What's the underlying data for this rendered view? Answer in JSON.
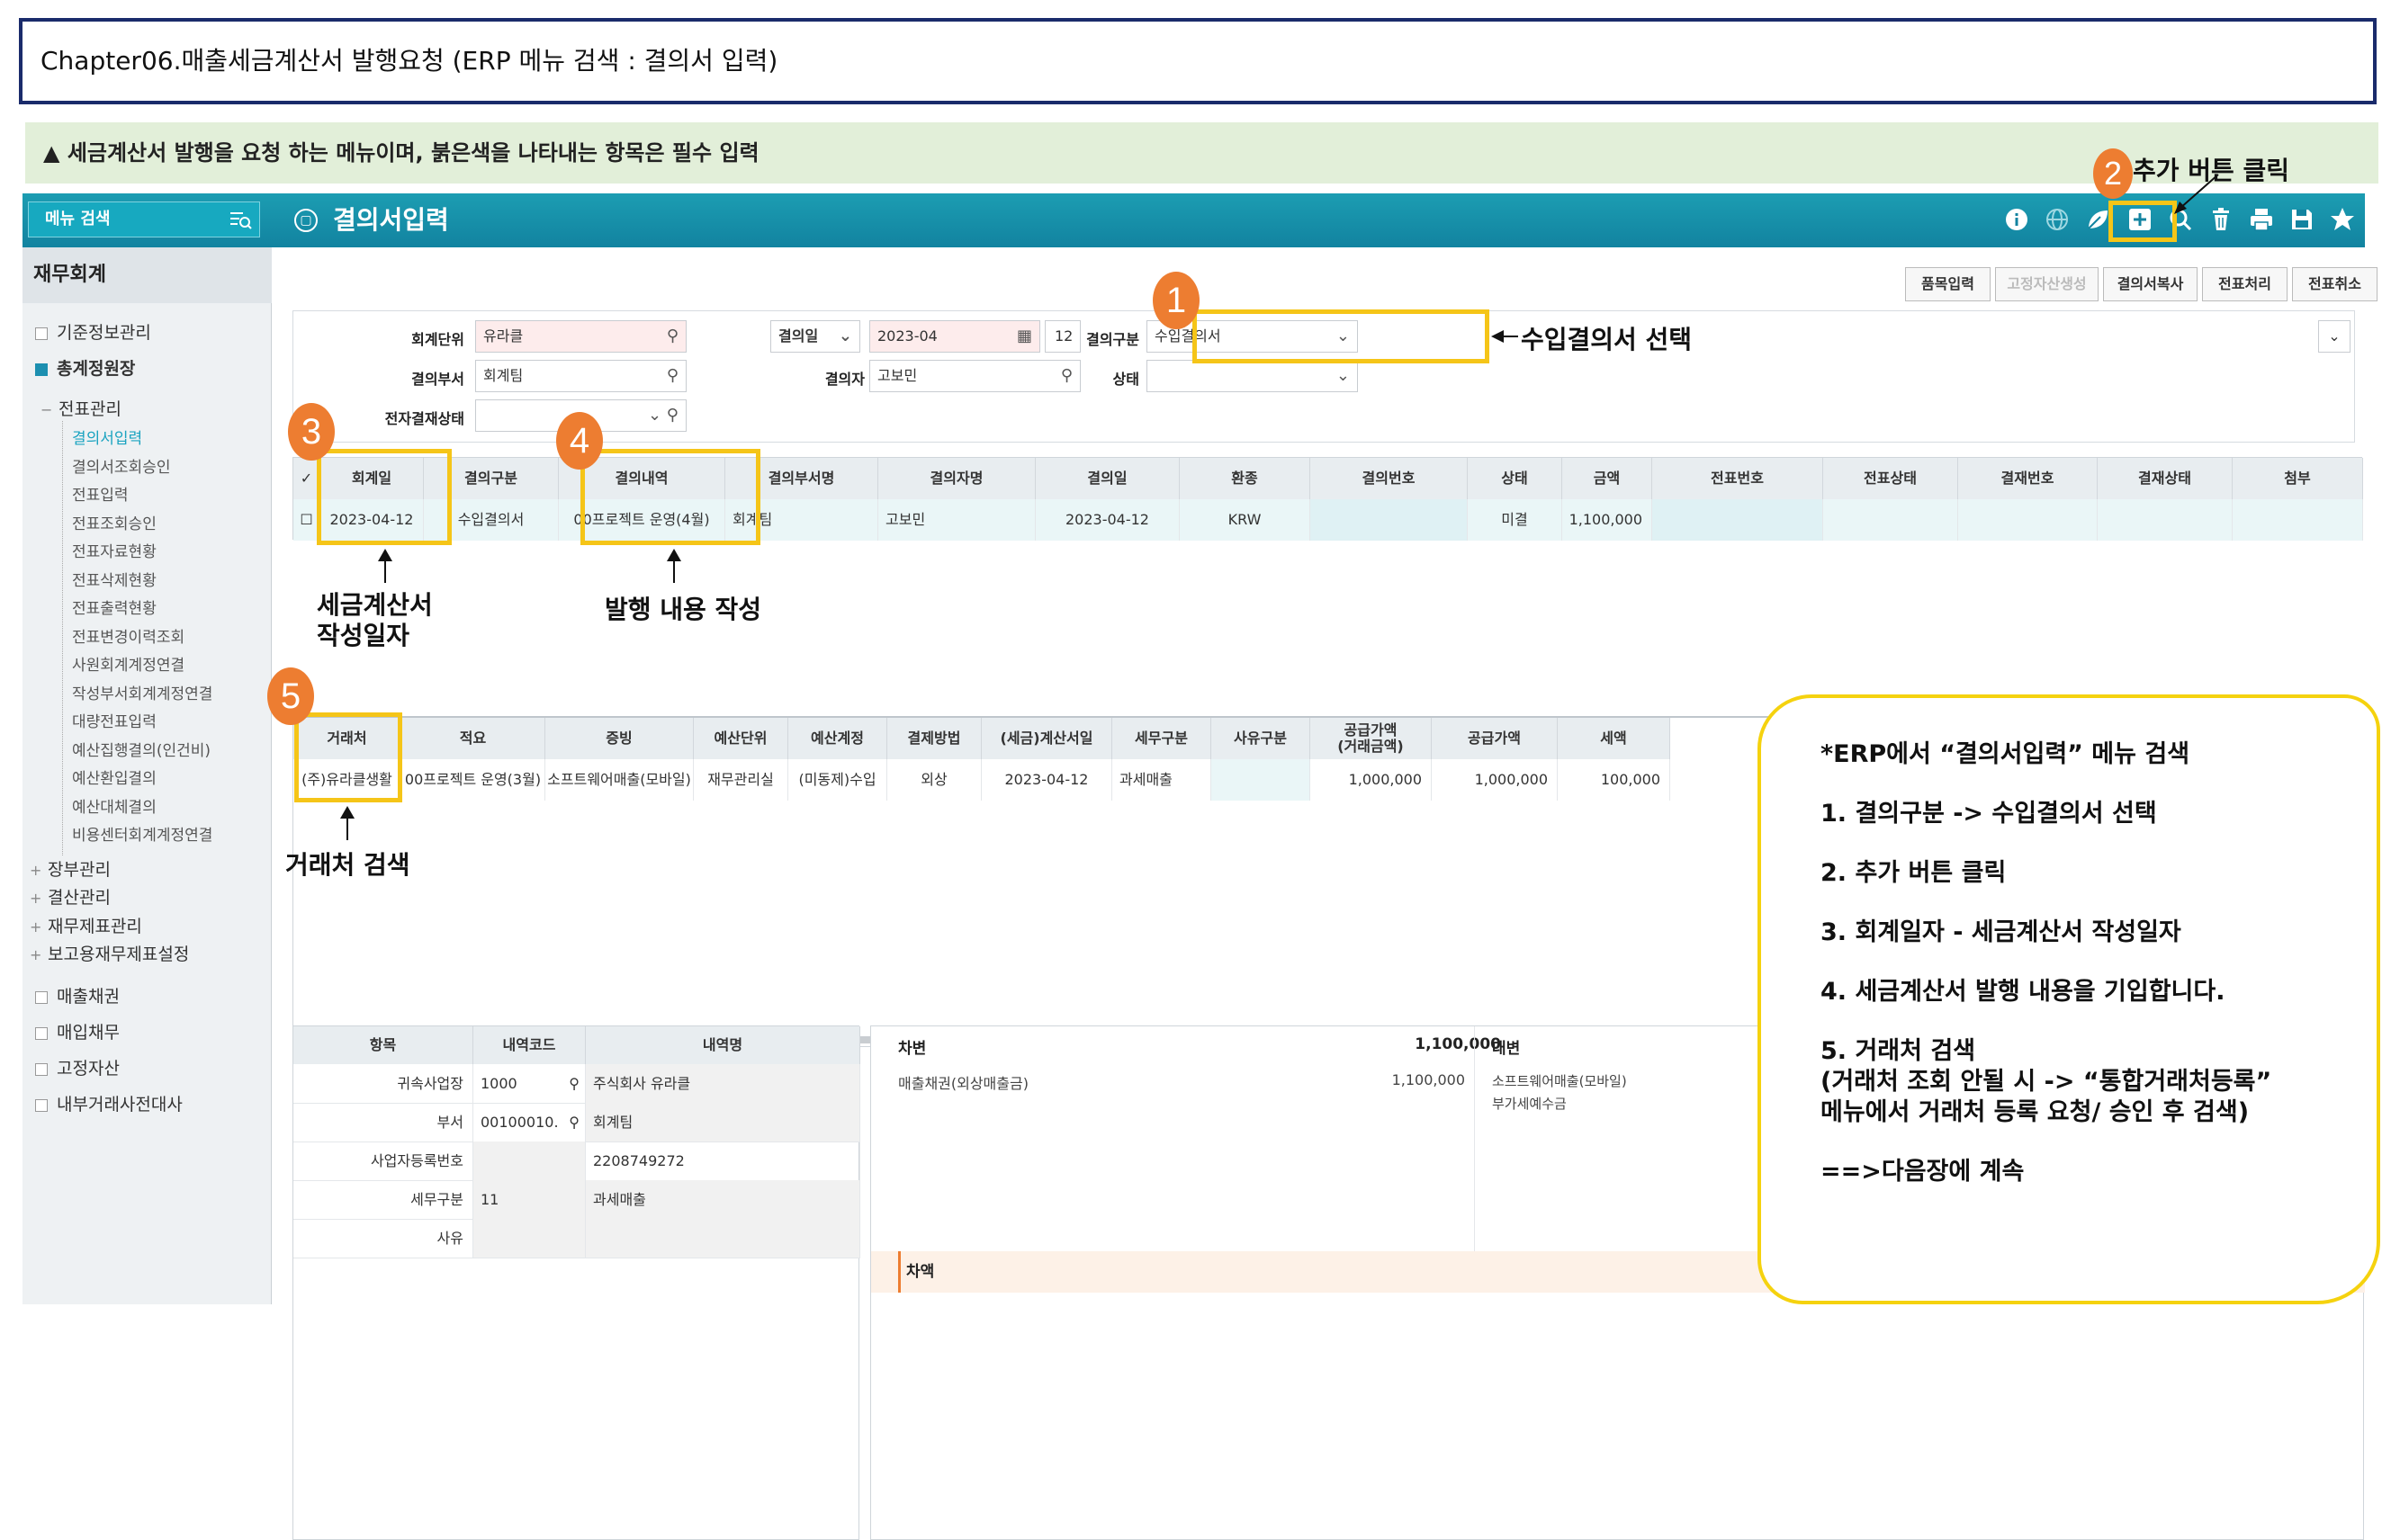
{
  "chapter": {
    "title": "Chapter06.매출세금계산서 발행요청  (ERP 메뉴 검색 : 결의서 입력)"
  },
  "notice": {
    "text": "▲ 세금계산서 발행을 요청 하는 메뉴이며, 붉은색을 나타내는 항목은 필수 입력"
  },
  "header": {
    "menu_search": "메뉴 검색",
    "screen_title": "결의서입력",
    "icons": [
      "info-icon",
      "globe-icon",
      "leaf-icon",
      "add-icon",
      "search-icon",
      "delete-icon",
      "print-icon",
      "save-icon",
      "star-icon"
    ],
    "color": "#1c9db2"
  },
  "sidebar": {
    "title": "재무회계",
    "top_items": [
      "기준정보관리",
      "총계정원장"
    ],
    "group": "전표관리",
    "sub_items": [
      "결의서입력",
      "결의서조회승인",
      "전표입력",
      "전표조회승인",
      "전표자료현황",
      "전표삭제현황",
      "전표출력현황",
      "전표변경이력조회",
      "사원회계계정연결",
      "작성부서회계계정연결",
      "대량전표입력",
      "예산집행결의(인건비)",
      "예산환입결의",
      "예산대체결의",
      "비용센터회계계정연결"
    ],
    "more_groups": [
      "장부관리",
      "결산관리",
      "재무제표관리",
      "보고용재무제표설정"
    ],
    "bottom_items": [
      "매출채권",
      "매입채무",
      "고정자산",
      "내부거래사전대사"
    ]
  },
  "toolbar": {
    "buttons": [
      "품목입력",
      "고정자산생성",
      "결의서복사",
      "전표처리",
      "전표취소"
    ]
  },
  "search": {
    "unit_label": "회계단위",
    "unit_value": "유라클",
    "dept_label": "결의부서",
    "dept_value": "회계팀",
    "approval_label": "전자결재상태",
    "approval_value": "",
    "date_label": "결의일",
    "date_value": "2023-04",
    "date_day": "12",
    "person_label": "결의자",
    "person_value": "고보민",
    "type_label": "결의구분",
    "type_value": "수입결의서",
    "state_label": "상태",
    "state_value": ""
  },
  "grid1": {
    "headers": [
      "회계일",
      "결의구분",
      "결의내역",
      "결의부서명",
      "결의자명",
      "결의일",
      "환종",
      "결의번호",
      "상태",
      "금액",
      "전표번호",
      "전표상태",
      "결재번호",
      "결재상태",
      "첨부"
    ],
    "row": [
      "2023-04-12",
      "수입결의서",
      "00프로젝트 운영(4월)",
      "회계팀",
      "고보민",
      "2023-04-12",
      "KRW",
      "",
      "미결",
      "1,100,000",
      "",
      "",
      "",
      "",
      ""
    ]
  },
  "grid2": {
    "headers": [
      "거래처",
      "적요",
      "증빙",
      "예산단위",
      "예산계정",
      "결제방법",
      "(세금)계산서일",
      "세무구분",
      "사유구분",
      "공급가액\n(거래금액)",
      "공급가액",
      "세액"
    ],
    "row": [
      "(주)유라클생활",
      "00프로젝트 운영(3월)",
      "소프트웨어매출(모바일)",
      "재무관리실",
      "(미동제)수입",
      "외상",
      "2023-04-12",
      "과세매출",
      "",
      "1,000,000",
      "1,000,000",
      "100,000"
    ]
  },
  "detail": {
    "headers": [
      "항목",
      "내역코드",
      "내역명"
    ],
    "rows": [
      [
        "귀속사업장",
        "1000",
        "주식회사 유라클"
      ],
      [
        "부서",
        "00100010.",
        "회계팀"
      ],
      [
        "사업자등록번호",
        "",
        "2208749272"
      ],
      [
        "세무구분",
        "11",
        "과세매출"
      ],
      [
        "사유",
        "",
        ""
      ]
    ]
  },
  "journal": {
    "debit_label": "차변",
    "debit_total": "1,100,000",
    "credit_label": "대변",
    "debit_line": "매출채권(외상매출금)",
    "debit_amount": "1,100,000",
    "credit_lines": [
      "소프트웨어매출(모바일)",
      "부가세예수금"
    ],
    "diff_label": "차액"
  },
  "annotations": {
    "n1": "1",
    "n2": "2",
    "n3": "3",
    "n4": "4",
    "n5": "5",
    "a1": "수입결의서 선택",
    "a2": "추가 버튼 클릭",
    "a3_l1": "세금계산서",
    "a3_l2": "작성일자",
    "a4": "발행 내용 작성",
    "a5": "거래처 검색",
    "highlight_color": "#f5c518",
    "circle_color": "#ed7d31"
  },
  "note": {
    "lines": [
      "*ERP에서 “결의서입력” 메뉴 검색",
      "1. 결의구분 -> 수입결의서 선택",
      "2. 추가 버튼 클릭",
      "3. 회계일자 - 세금계산서 작성일자",
      "4. 세금계산서 발행 내용을 기입합니다.",
      "5. 거래처 검색",
      " (거래처 조회 안될 시 -> “통합거래처등록”",
      "메뉴에서 거래처 등록 요청/ 승인 후 검색)",
      "==>다음장에 계속"
    ]
  }
}
